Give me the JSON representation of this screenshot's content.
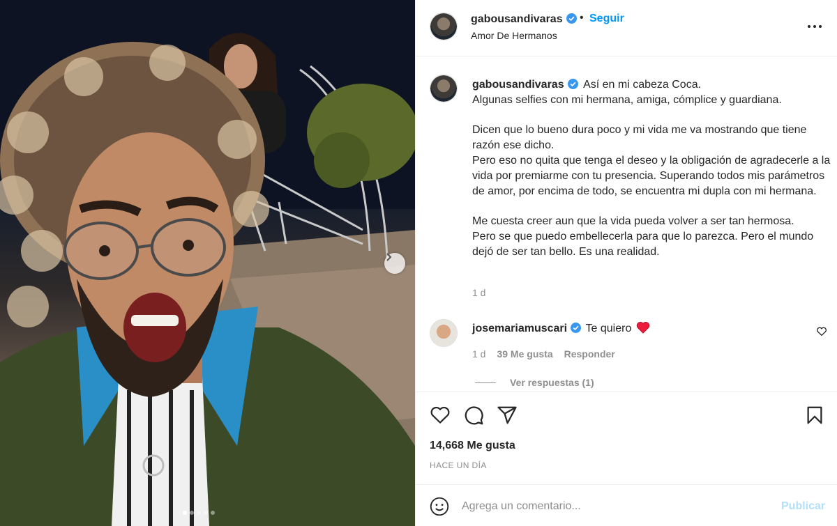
{
  "post": {
    "username": "gabousandivaras",
    "follow_label": "Seguir",
    "separator": "•",
    "subtitle": "Amor De Hermanos",
    "caption_first": "Así en mi cabeza Coca.",
    "caption_body": "Algunas selfies con mi hermana, amiga, cómplice y guardiana.\n\nDicen que lo bueno dura poco y mi vida me va mostrando que tiene razón ese dicho.\nPero eso no quita que tenga el deseo y la obligación de agradecerle a la vida por premiarme con tu presencia. Superando todos mis parámetros de amor, por encima de todo, se encuentra mi dupla con mi hermana.\n\nMe cuesta creer aun que la vida pueda volver a ser tan hermosa.\nPero se que puedo embellecerla para que lo parezca. Pero el mundo dejó de ser tan bello. Es una realidad.",
    "caption_time": "1 d"
  },
  "comment": {
    "username": "josemariamuscari",
    "text": "Te quiero",
    "time": "1 d",
    "likes": "39 Me gusta",
    "reply_label": "Responder",
    "view_replies": "Ver respuestas (1)"
  },
  "actions": {
    "likes_count": "14,668 Me gusta",
    "posted_ago": "HACE UN DÍA"
  },
  "comment_bar": {
    "placeholder": "Agrega un comentario...",
    "publish_label": "Publicar"
  },
  "carousel": {
    "slide_count": 5,
    "active_index": 0
  },
  "colors": {
    "accent": "#0095f6",
    "verified": "#3897f0",
    "heart": "#ed4956",
    "publish_disabled": "#b2dffc",
    "muted": "#8e8e8e"
  }
}
